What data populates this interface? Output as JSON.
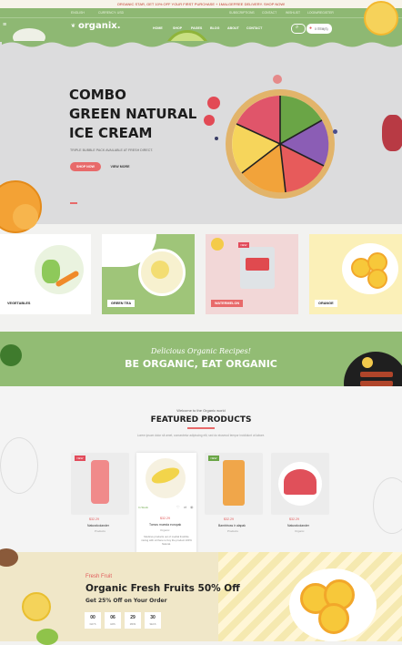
{
  "promo_bar": "ORGANIC STAR, GET 10% OFF YOUR FIRST PURCHASE + 1MALGEFREE DELIVERY. SHOP NOW!",
  "topbar": {
    "left1": "ENGLISH",
    "left2": "CURRENCY: USD",
    "right": [
      "SUBSCRIPTIONS",
      "CONTACT",
      "WISHLIST",
      "LOGIN/REGISTER"
    ]
  },
  "header": {
    "logo": "organix.",
    "nav": [
      "HOME",
      "SHOP",
      "PAGES",
      "BLOG",
      "ABOUT",
      "CONTACT"
    ],
    "search": "",
    "cart": "0 ITEM(S)"
  },
  "hero": {
    "line1": "COMBO",
    "line2": "GREEN NATURAL",
    "line3": "ICE CREAM",
    "subtitle": "TRIPLE BUBBLE PACK AVAILABLE AT FRESH DIRECT.",
    "shop_button": "SHOP NOW",
    "view_button": "VIEW MORE"
  },
  "categories": [
    {
      "label": "VEGETABLES"
    },
    {
      "label": "GREEN TEA"
    },
    {
      "label": "WATERMELON",
      "badge": "NEW"
    },
    {
      "label": "ORANGE"
    }
  ],
  "band": {
    "script": "Delicious Organic Recipes!",
    "title": "BE ORGANIC, EAT ORGANIC"
  },
  "featured": {
    "welcome": "Welcome to the Organic world",
    "title": "FEATURED PRODUCTS",
    "desc": "Lorem ipsum dolor sit amet, consectetur adipiscing elit, sed do eiusmod tempor incididunt ut labore.",
    "products": [
      {
        "price": "$32.29",
        "old": "$36.99",
        "name": "Naturalcolander",
        "cat": "Products",
        "badge": "NEW"
      },
      {
        "price": "$32.29",
        "old": "",
        "name": "Tomos muesta europak",
        "cat": "Organic",
        "badge": ""
      },
      {
        "price": "$32.29",
        "old": "$36.99",
        "name": "Bambtruss ir alapak",
        "cat": "Products",
        "badge": "NEW"
      },
      {
        "price": "$32.29",
        "old": "$36.99",
        "name": "Naturalcolander",
        "cat": "Organic",
        "badge": ""
      }
    ],
    "stock": "In Stock",
    "card_desc": "Medicus products out of medial frostbite mixing with oil there to buy the product 100% Natural.",
    "add_cart": "ADD TO CART"
  },
  "deal": {
    "kicker": "Fresh Fruit",
    "title": "Organic Fresh Fruits 50% Off",
    "subtitle": "Get 25% Off on Your Order",
    "countdown": [
      {
        "value": "00",
        "label": "DAYS"
      },
      {
        "value": "06",
        "label": "HRS"
      },
      {
        "value": "29",
        "label": "MINS"
      },
      {
        "value": "30",
        "label": "SECS"
      }
    ]
  },
  "colors": {
    "green": "#8eb873",
    "accent_red": "#e05a5a",
    "dark": "#1c1c1c"
  }
}
